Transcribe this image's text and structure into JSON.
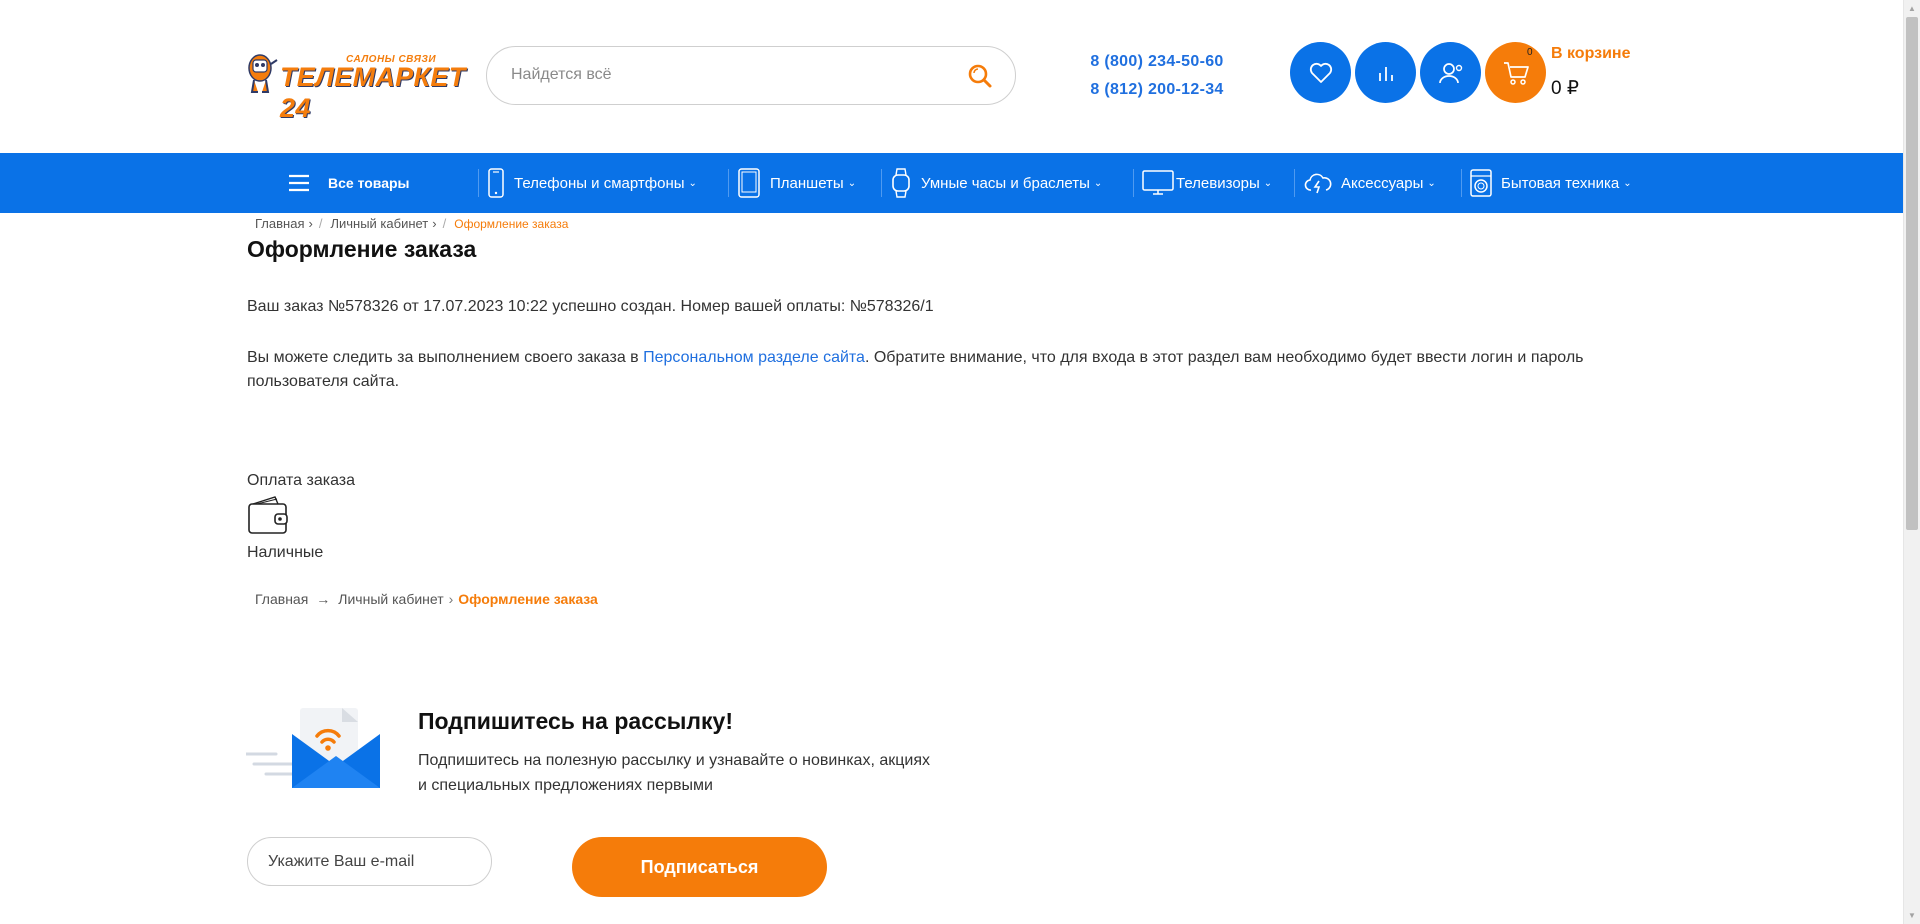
{
  "header": {
    "logo_small": "САЛОНЫ СВЯЗИ",
    "logo_big": "ТЕЛЕМАРКЕТ 24",
    "search_placeholder": "Найдется всё",
    "phones": [
      "8 (800) 234-50-60",
      "8 (812) 200-12-34"
    ],
    "cart_count": "0",
    "cart_label": "В корзине",
    "cart_sum": "0 ₽"
  },
  "nav": {
    "all_label": "Все товары",
    "items": [
      {
        "label": "Телефоны и смартфоны",
        "icon": "phone-icon"
      },
      {
        "label": "Планшеты",
        "icon": "tablet-icon"
      },
      {
        "label": "Умные часы и браслеты",
        "icon": "watch-icon"
      },
      {
        "label": "Телевизоры",
        "icon": "tv-icon"
      },
      {
        "label": "Аксессуары",
        "icon": "cloud-lightning-icon"
      },
      {
        "label": "Бытовая техника",
        "icon": "washing-machine-icon"
      }
    ]
  },
  "breadcrumb_top": {
    "items": [
      "Главная",
      "Личный кабинет"
    ],
    "current": "Оформление заказа"
  },
  "main": {
    "title": "Оформление заказа",
    "order_text": "Ваш заказ №578326 от 17.07.2023 10:22 успешно создан. Номер вашей оплаты: №578326/1",
    "info_before": "Вы можете следить за выполнением своего заказа в ",
    "info_link": "Персональном разделе сайта",
    "info_after": ". Обратите внимание, что для входа в этот раздел вам необходимо будет ввести логин и пароль пользователя сайта.",
    "payment_title": "Оплата заказа",
    "payment_method": "Наличные"
  },
  "breadcrumb_bottom": {
    "home": "Главная",
    "arrow": "→",
    "cabinet": "Личный кабинет",
    "sep": "›",
    "current": "Оформление заказа"
  },
  "subscribe": {
    "title": "Подпишитесь на рассылку!",
    "text": "Подпишитесь на полезную рассылку и узнавайте о новинках, акциях и специальных предложениях первыми",
    "email_placeholder": "Укажите Ваш e-mail",
    "button_label": "Подписаться"
  },
  "colors": {
    "brand_blue": "#0a72e7",
    "brand_orange": "#f57c0a",
    "link_blue": "#1f6fdf"
  }
}
